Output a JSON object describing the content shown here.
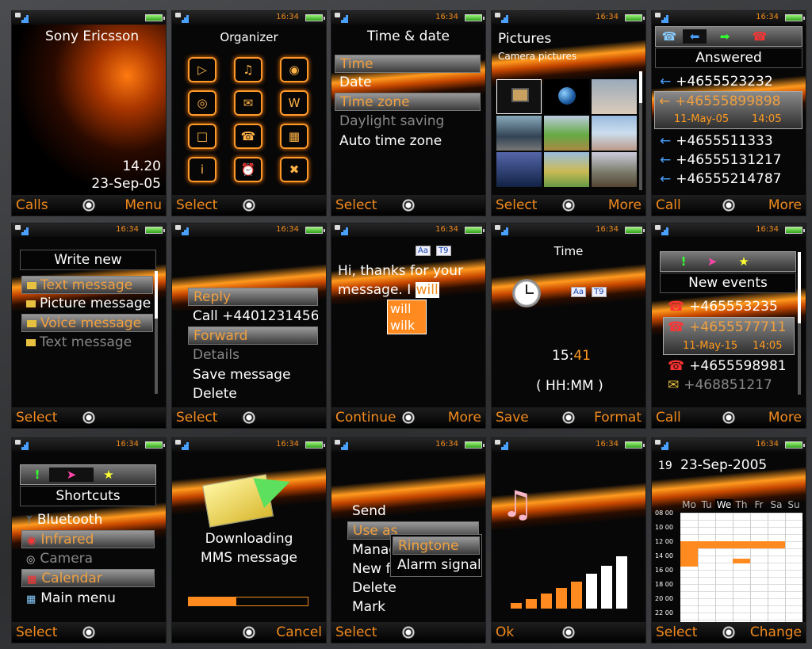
{
  "status": {
    "time": "16:34"
  },
  "s1": {
    "brand": "Sony Ericsson",
    "clock": "14.20",
    "date": "23-Sep-05",
    "left": "Calls",
    "right": "Menu"
  },
  "s2": {
    "title": "Organizer",
    "left": "Select"
  },
  "s3": {
    "title": "Time & date",
    "items": [
      "Time",
      "Date",
      "Time zone",
      "Daylight saving",
      "Auto time zone"
    ],
    "left": "Select"
  },
  "s4": {
    "title": "Pictures",
    "subtitle": "Camera pictures",
    "left": "Select",
    "right": "More"
  },
  "s5": {
    "header": "Answered",
    "calls": [
      "+4655523232",
      "+46555899898",
      "+4655511333",
      "+46555131217",
      "+46555214787"
    ],
    "date": "11-May-05",
    "time": "14:05",
    "left": "Call",
    "right": "More"
  },
  "s6": {
    "header": "Write new",
    "items": [
      "Text message",
      "Picture message",
      "Voice message",
      "Text message"
    ],
    "left": "Select"
  },
  "s7": {
    "items": [
      "Reply",
      "Call +4401231456",
      "Forward",
      "Details",
      "Save message",
      "Delete"
    ],
    "left": "Select"
  },
  "s8": {
    "line1": "Hi, thanks for your",
    "line2": "message. I",
    "typed": "will",
    "suggestions": [
      "will",
      "wilk"
    ],
    "badge1": "Aa",
    "badge2": "T9",
    "left": "Continue",
    "right": "More"
  },
  "s9": {
    "title": "Time",
    "value_h": "15:",
    "value_m": "41",
    "format": "( HH:MM )",
    "badge1": "Aa",
    "badge2": "T9",
    "left": "Save",
    "right": "Format"
  },
  "s10": {
    "header": "New events",
    "calls": [
      "+465553235",
      "+4655577711",
      "+4655598981",
      "+468851217"
    ],
    "date": "11-May-15",
    "time": "14:05",
    "left": "Call",
    "right": "More"
  },
  "s11": {
    "header": "Shortcuts",
    "items": [
      "Bluetooth",
      "Infrared",
      "Camera",
      "Calendar",
      "Main menu"
    ],
    "left": "Select"
  },
  "s12": {
    "line1": "Downloading",
    "line2": "MMS message",
    "progress": 0.4,
    "right": "Cancel"
  },
  "s13": {
    "items": [
      "Send",
      "Use as",
      "Manage",
      "New f",
      "Delete",
      "Mark"
    ],
    "submenu": [
      "Ringtone",
      "Alarm signal"
    ],
    "left": "Select"
  },
  "s14": {
    "left": "Ok",
    "bars": [
      0.08,
      0.14,
      0.22,
      0.3,
      0.4,
      0.52,
      0.64,
      0.78
    ]
  },
  "s15": {
    "day": "19",
    "date": "23-Sep-2005",
    "days": [
      "Mo",
      "Tu",
      "We",
      "Th",
      "Fr",
      "Sa",
      "Su"
    ],
    "hours": [
      "08 00",
      "10 00",
      "12 00",
      "14 00",
      "16 00",
      "18 00",
      "20 00",
      "22 00"
    ],
    "left": "Select",
    "right": "Change"
  },
  "colors": {
    "accent": "#f28a1c",
    "highlight": "#ff9a1e"
  }
}
